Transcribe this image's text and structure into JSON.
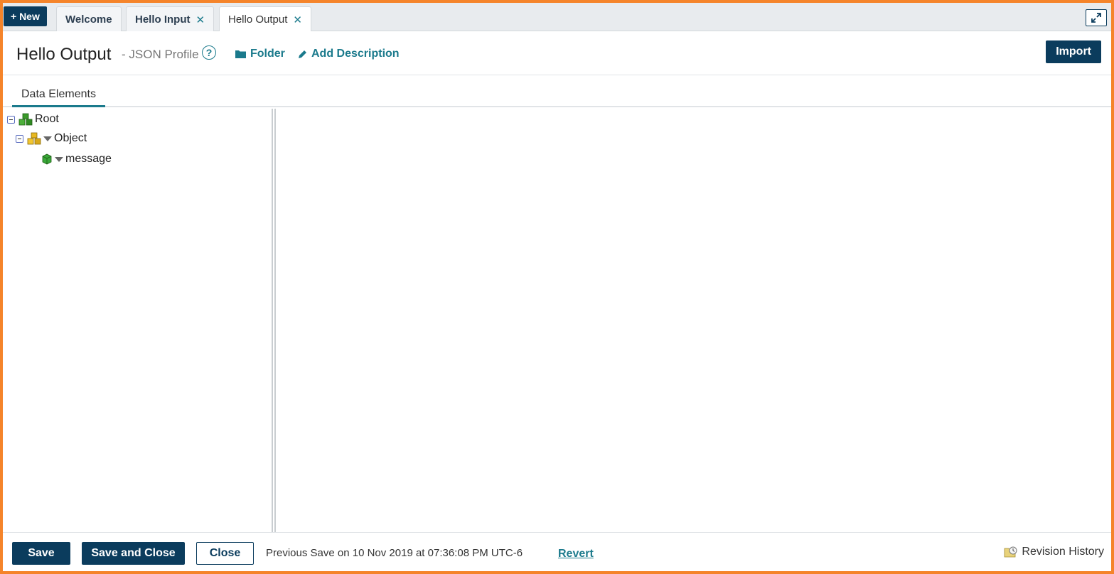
{
  "tabstrip": {
    "new_label": "+ New",
    "tabs": [
      {
        "label": "Welcome",
        "closable": false,
        "active": false
      },
      {
        "label": "Hello Input",
        "closable": true,
        "active": false
      },
      {
        "label": "Hello Output",
        "closable": true,
        "active": true
      }
    ],
    "close_glyph": "✕"
  },
  "header": {
    "title": "Hello Output",
    "subtitle": "- JSON Profile",
    "help_glyph": "?",
    "folder_label": "Folder",
    "add_description_label": "Add Description",
    "import_label": "Import"
  },
  "section": {
    "tab_label": "Data Elements"
  },
  "tree": {
    "nodes": [
      {
        "label": "Root",
        "icon": "root-cubes-icon",
        "color": "#3a9a2a"
      },
      {
        "label": "Object",
        "icon": "object-cubes-icon",
        "color": "#e0b020"
      },
      {
        "label": "message",
        "icon": "element-cube-icon",
        "color": "#3aa83a"
      }
    ]
  },
  "footer": {
    "save_label": "Save",
    "save_close_label": "Save and Close",
    "close_label": "Close",
    "previous_save": "Previous Save on 10 Nov 2019 at 07:36:08 PM UTC-6",
    "revert_label": "Revert",
    "revision_history_label": "Revision History"
  },
  "colors": {
    "frame_border": "#f5842a",
    "primary": "#0b3c5d",
    "accent": "#1b7a8c"
  }
}
